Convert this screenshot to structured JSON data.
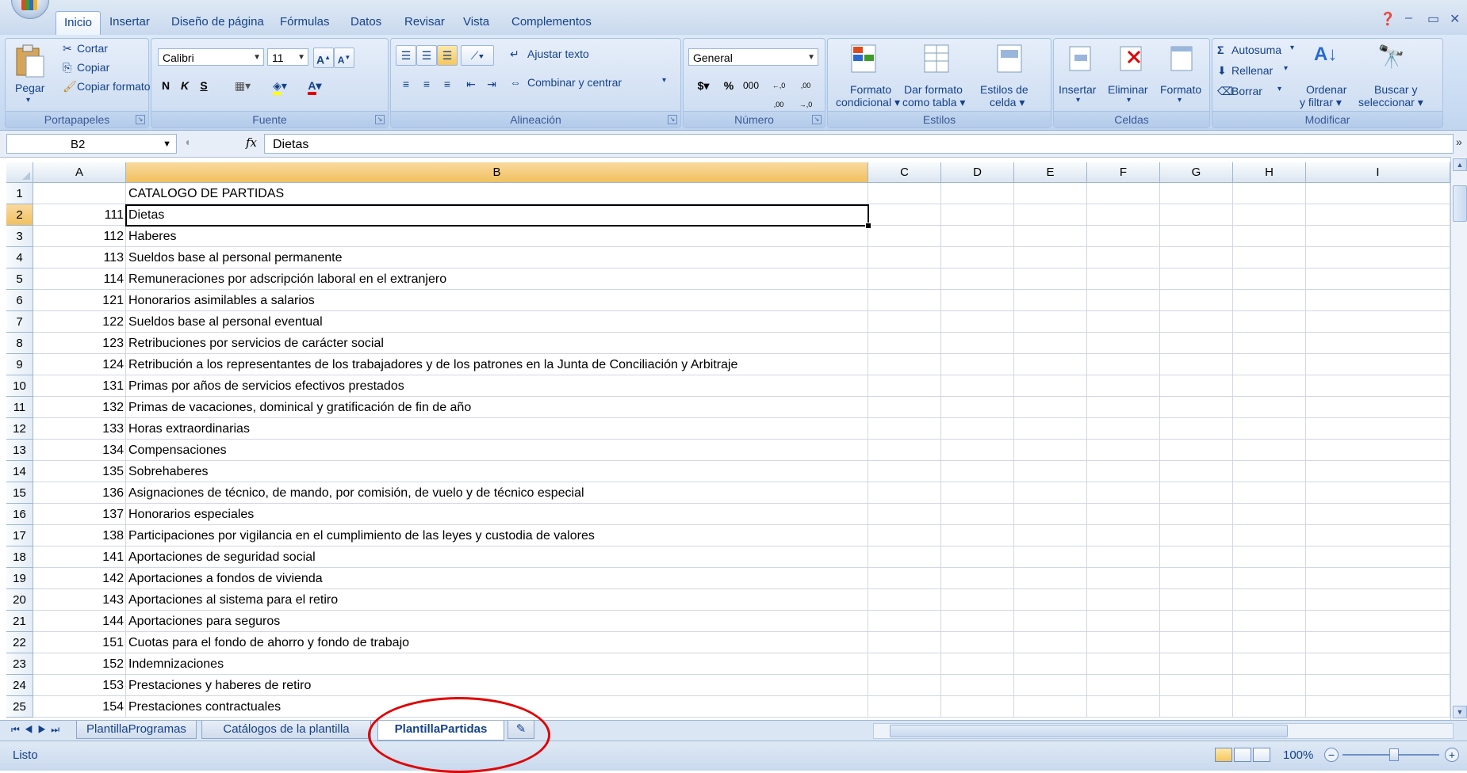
{
  "ribbon_tabs": [
    "Inicio",
    "Insertar",
    "Diseño de página",
    "Fórmulas",
    "Datos",
    "Revisar",
    "Vista",
    "Complementos"
  ],
  "clipboard": {
    "paste": "Pegar",
    "cut": "Cortar",
    "copy": "Copiar",
    "format_painter": "Copiar formato",
    "label": "Portapapeles"
  },
  "font": {
    "name": "Calibri",
    "size": "11",
    "bold": "N",
    "italic": "K",
    "underline": "S",
    "label": "Fuente"
  },
  "alignment": {
    "wrap": "Ajustar texto",
    "merge": "Combinar y centrar",
    "label": "Alineación"
  },
  "number": {
    "format": "General",
    "currency": "$",
    "percent": "%",
    "thousands": "000",
    "inc_decimal": "←,0 ,00",
    "dec_decimal": ",00 →,0",
    "label": "Número"
  },
  "styles": {
    "conditional": "Formato condicional",
    "as_table": "Dar formato como tabla",
    "cell_styles": "Estilos de celda",
    "label": "Estilos"
  },
  "cells": {
    "insert": "Insertar",
    "delete": "Eliminar",
    "format": "Formato",
    "label": "Celdas"
  },
  "editing": {
    "autosum": "Autosuma",
    "fill": "Rellenar",
    "clear": "Borrar",
    "sort": "Ordenar y filtrar",
    "find": "Buscar y seleccionar",
    "label": "Modificar"
  },
  "formula_bar": {
    "name_box": "B2",
    "fx": "fx",
    "content": "Dietas"
  },
  "columns": [
    "A",
    "B",
    "C",
    "D",
    "E",
    "F",
    "G",
    "H",
    "I"
  ],
  "rows": [
    {
      "n": "1",
      "a": "",
      "b": "CATALOGO DE PARTIDAS"
    },
    {
      "n": "2",
      "a": "111",
      "b": "Dietas"
    },
    {
      "n": "3",
      "a": "112",
      "b": "Haberes"
    },
    {
      "n": "4",
      "a": "113",
      "b": "Sueldos base al personal permanente"
    },
    {
      "n": "5",
      "a": "114",
      "b": "Remuneraciones por adscripción laboral en el extranjero"
    },
    {
      "n": "6",
      "a": "121",
      "b": "Honorarios asimilables a salarios"
    },
    {
      "n": "7",
      "a": "122",
      "b": "Sueldos base al personal eventual"
    },
    {
      "n": "8",
      "a": "123",
      "b": "Retribuciones por servicios de carácter social"
    },
    {
      "n": "9",
      "a": "124",
      "b": "Retribución a los representantes de los trabajadores y de los patrones en la Junta de Conciliación y Arbitraje"
    },
    {
      "n": "10",
      "a": "131",
      "b": "Primas por años de servicios efectivos prestados"
    },
    {
      "n": "11",
      "a": "132",
      "b": "Primas de vacaciones, dominical y gratificación de fin de año"
    },
    {
      "n": "12",
      "a": "133",
      "b": "Horas extraordinarias"
    },
    {
      "n": "13",
      "a": "134",
      "b": "Compensaciones"
    },
    {
      "n": "14",
      "a": "135",
      "b": "Sobrehaberes"
    },
    {
      "n": "15",
      "a": "136",
      "b": "Asignaciones de técnico, de mando, por comisión, de vuelo y de técnico especial"
    },
    {
      "n": "16",
      "a": "137",
      "b": "Honorarios especiales"
    },
    {
      "n": "17",
      "a": "138",
      "b": "Participaciones por vigilancia en el cumplimiento de las leyes y custodia de valores"
    },
    {
      "n": "18",
      "a": "141",
      "b": "Aportaciones de seguridad social"
    },
    {
      "n": "19",
      "a": "142",
      "b": "Aportaciones a fondos de vivienda"
    },
    {
      "n": "20",
      "a": "143",
      "b": "Aportaciones al sistema para el retiro"
    },
    {
      "n": "21",
      "a": "144",
      "b": "Aportaciones para seguros"
    },
    {
      "n": "22",
      "a": "151",
      "b": "Cuotas para el fondo de ahorro y fondo de trabajo"
    },
    {
      "n": "23",
      "a": "152",
      "b": "Indemnizaciones"
    },
    {
      "n": "24",
      "a": "153",
      "b": "Prestaciones y haberes de retiro"
    },
    {
      "n": "25",
      "a": "154",
      "b": "Prestaciones contractuales"
    }
  ],
  "sheet_tabs": [
    "PlantillaProgramas",
    "Catálogos de la plantilla",
    "PlantillaPartidas"
  ],
  "active_sheet": "PlantillaPartidas",
  "status": {
    "text": "Listo",
    "zoom": "100%"
  },
  "colors": {
    "annotation": "#e10000",
    "selection": "#f1c15f",
    "ribbon_text": "#15428b"
  }
}
